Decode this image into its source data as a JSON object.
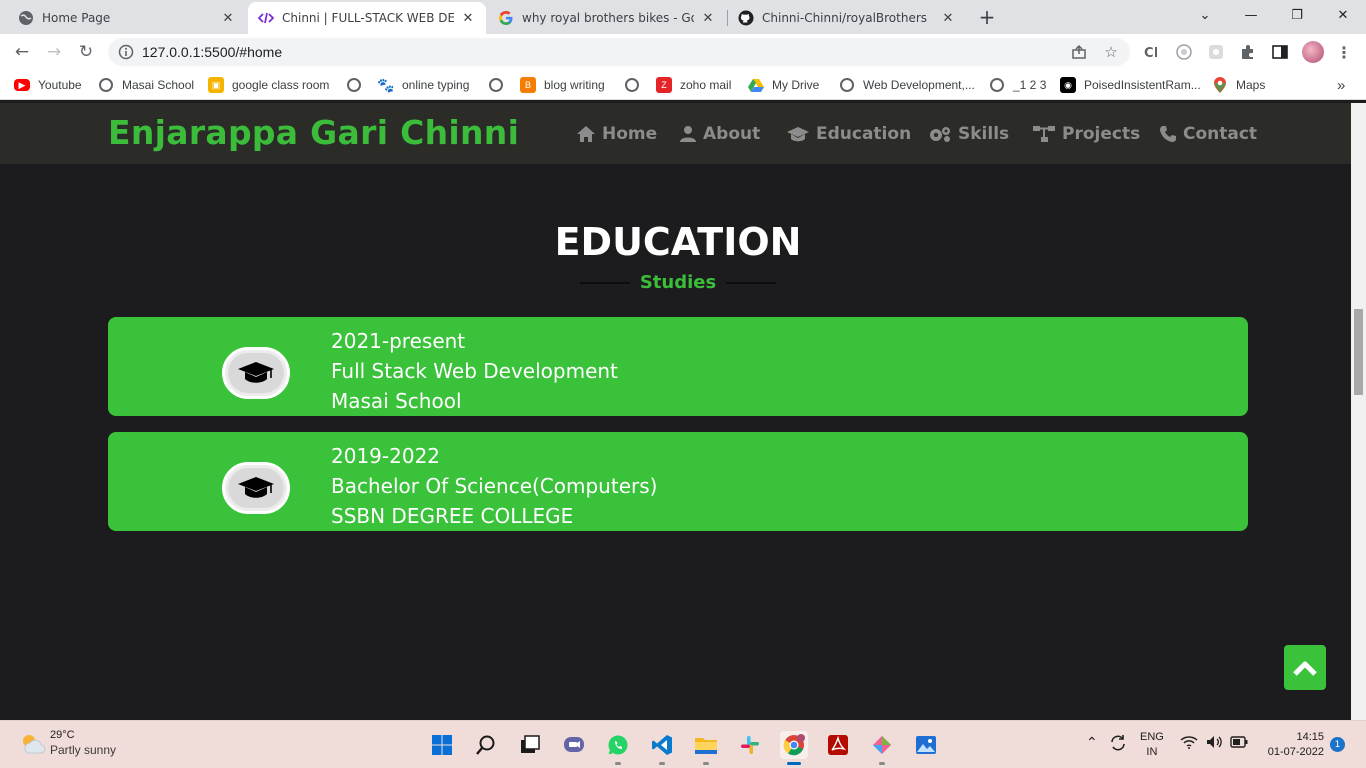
{
  "browser": {
    "tabs": [
      {
        "title": "Home Page",
        "icon": "globe-icon",
        "active": false
      },
      {
        "title": "Chinni | FULL-STACK WEB DEVELO",
        "icon": "code-icon",
        "active": true
      },
      {
        "title": "why royal brothers bikes - Googl",
        "icon": "google-icon",
        "active": false
      },
      {
        "title": "Chinni-Chinni/royalBrothers",
        "icon": "github-icon",
        "active": false
      }
    ],
    "url": "127.0.0.1:5500/#home",
    "bookmarks": [
      {
        "label": "Youtube",
        "icon": "youtube-icon"
      },
      {
        "label": "Masai School",
        "icon": "globe-icon"
      },
      {
        "label": "google class room",
        "icon": "classroom-icon"
      },
      {
        "label": "online typing",
        "icon": "paw-icon"
      },
      {
        "label": "blog writing",
        "icon": "blogger-icon"
      },
      {
        "label": "zoho mail",
        "icon": "zoho-icon"
      },
      {
        "label": "My Drive",
        "icon": "drive-icon"
      },
      {
        "label": "Web Development,...",
        "icon": "globe-icon"
      },
      {
        "label": "_1 2 3",
        "icon": "globe-icon"
      },
      {
        "label": "PoisedInsistentRam...",
        "icon": "replit-icon"
      },
      {
        "label": "Maps",
        "icon": "maps-icon"
      }
    ],
    "more_bookmarks": "»"
  },
  "site": {
    "brand": "Enjarappa Gari Chinni",
    "nav": [
      {
        "label": "Home",
        "icon": "home-icon"
      },
      {
        "label": "About",
        "icon": "user-icon"
      },
      {
        "label": "Education",
        "icon": "graduation-cap-icon"
      },
      {
        "label": "Skills",
        "icon": "gears-icon"
      },
      {
        "label": "Projects",
        "icon": "sitemap-icon"
      },
      {
        "label": "Contact",
        "icon": "phone-icon"
      }
    ],
    "section_title": "EDUCATION",
    "section_subtitle": "Studies",
    "education": [
      {
        "period": "2021-present",
        "course": "Full Stack Web Development",
        "institution": "Masai School"
      },
      {
        "period": "2019-2022",
        "course": "Bachelor Of Science(Computers)",
        "institution": "SSBN DEGREE COLLEGE"
      }
    ],
    "accent_color": "#3ac23a",
    "background_color": "#1c1c1e"
  },
  "taskbar": {
    "weather_temp": "29°C",
    "weather_condition": "Partly sunny",
    "language_line1": "ENG",
    "language_line2": "IN",
    "time": "14:15",
    "date": "01-07-2022",
    "notification_count": "1"
  }
}
